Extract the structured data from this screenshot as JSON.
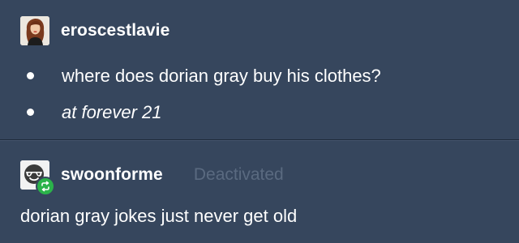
{
  "reblog_1": {
    "username": "eroscestlavie",
    "avatar_icon": "portrait-avatar-icon",
    "items": [
      {
        "text": "where does dorian gray buy his clothes?",
        "style": "normal"
      },
      {
        "text": "at forever 21",
        "style": "italic"
      }
    ]
  },
  "reblog_2": {
    "username": "swoonforme",
    "status": "Deactivated",
    "avatar_icon": "sunglasses-face-avatar-icon",
    "badge_icon": "reblog-icon",
    "text": "dorian gray jokes just never get old"
  },
  "colors": {
    "background": "#36465d",
    "text": "#ffffff",
    "muted": "#5a6a80",
    "reblog_badge": "#2bb34a"
  }
}
